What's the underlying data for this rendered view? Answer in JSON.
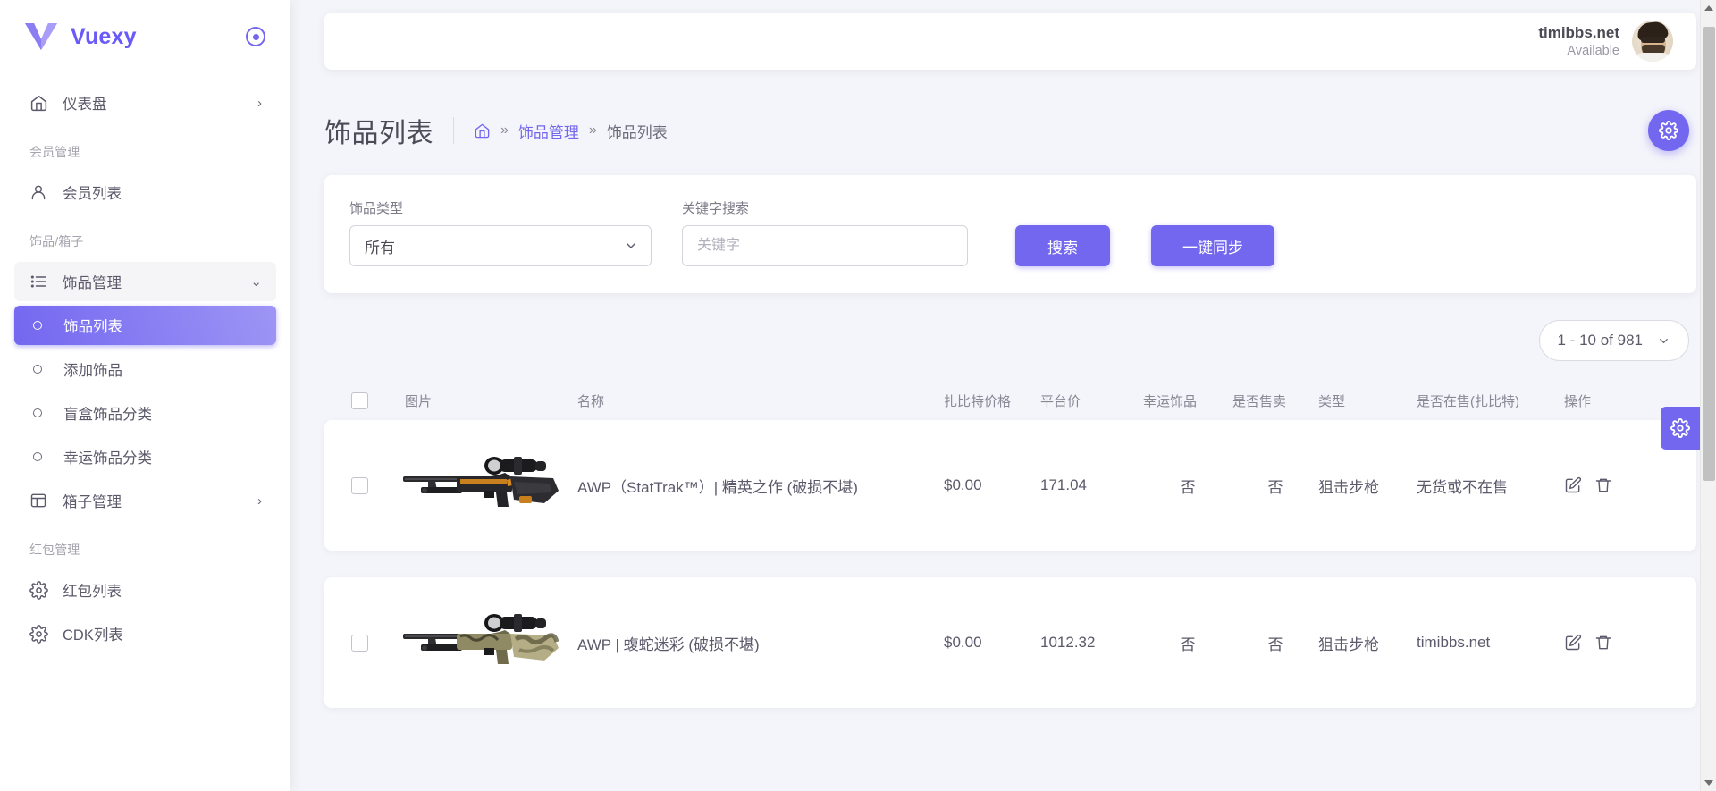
{
  "brand": {
    "name": "Vuexy",
    "logo_icon": "vuexy-logo",
    "pin_icon": "circle-pin-icon"
  },
  "sidebar": {
    "items": [
      {
        "label": "仪表盘",
        "icon": "home-icon",
        "chevron": "›",
        "type": "item"
      },
      {
        "label": "会员管理",
        "type": "section"
      },
      {
        "label": "会员列表",
        "icon": "user-icon",
        "type": "item"
      },
      {
        "label": "饰品/箱子",
        "type": "section"
      },
      {
        "label": "饰品管理",
        "icon": "list-icon",
        "chevron": "⌄",
        "type": "group",
        "open": true
      },
      {
        "label": "饰品列表",
        "type": "sub",
        "active": true
      },
      {
        "label": "添加饰品",
        "type": "sub"
      },
      {
        "label": "盲盒饰品分类",
        "type": "sub"
      },
      {
        "label": "幸运饰品分类",
        "type": "sub"
      },
      {
        "label": "箱子管理",
        "icon": "layout-icon",
        "chevron": "›",
        "type": "item"
      },
      {
        "label": "红包管理",
        "type": "section"
      },
      {
        "label": "红包列表",
        "icon": "gear-icon",
        "type": "item"
      },
      {
        "label": "CDK列表",
        "icon": "gear-icon",
        "type": "item"
      }
    ]
  },
  "topbar": {
    "user_name": "timibbs.net",
    "user_status": "Available",
    "avatar_icon": "user-avatar"
  },
  "page": {
    "title": "饰品列表",
    "breadcrumb": {
      "home_icon": "home-icon",
      "sep": "»",
      "items": [
        {
          "label": "饰品管理",
          "link": true
        },
        {
          "label": "饰品列表",
          "link": false
        }
      ]
    },
    "settings_fab_icon": "gear-icon",
    "gear_tab_icon": "gear-icon"
  },
  "filters": {
    "type_label": "饰品类型",
    "type_value": "所有",
    "type_options": [
      "所有"
    ],
    "keyword_label": "关键字搜索",
    "keyword_value": "",
    "keyword_placeholder": "关键字",
    "search_button": "搜索",
    "sync_button": "一键同步"
  },
  "pagination": {
    "label": "1 - 10 of 981",
    "chevron": "⌄"
  },
  "table": {
    "columns": [
      "图片",
      "名称",
      "扎比特价格",
      "平台价",
      "幸运饰品",
      "是否售卖",
      "类型",
      "是否在售(扎比特)",
      "操作"
    ],
    "select_all_checked": false,
    "rows": [
      {
        "checked": false,
        "image_icon": "awp-elite-build-rifle",
        "name": "AWP（StatTrak™）| 精英之作 (破损不堪)",
        "zbt_price": "$0.00",
        "platform_price": "171.04",
        "lucky": "否",
        "for_sale": "否",
        "type": "狙击步枪",
        "stock": "无货或不在售",
        "actions": [
          "edit-icon",
          "delete-icon"
        ]
      },
      {
        "checked": false,
        "image_icon": "awp-snake-camo-rifle",
        "name": "AWP | 蝮蛇迷彩 (破损不堪)",
        "zbt_price": "$0.00",
        "platform_price": "1012.32",
        "lucky": "否",
        "for_sale": "否",
        "type": "狙击步枪",
        "stock": "timibbs.net",
        "actions": [
          "edit-icon",
          "delete-icon"
        ]
      }
    ]
  },
  "colors": {
    "accent": "#7367f0",
    "accent_light": "#9e95f5",
    "page_bg": "#f4f5fa",
    "text": "#5b596a",
    "muted": "#a5a3ae"
  }
}
